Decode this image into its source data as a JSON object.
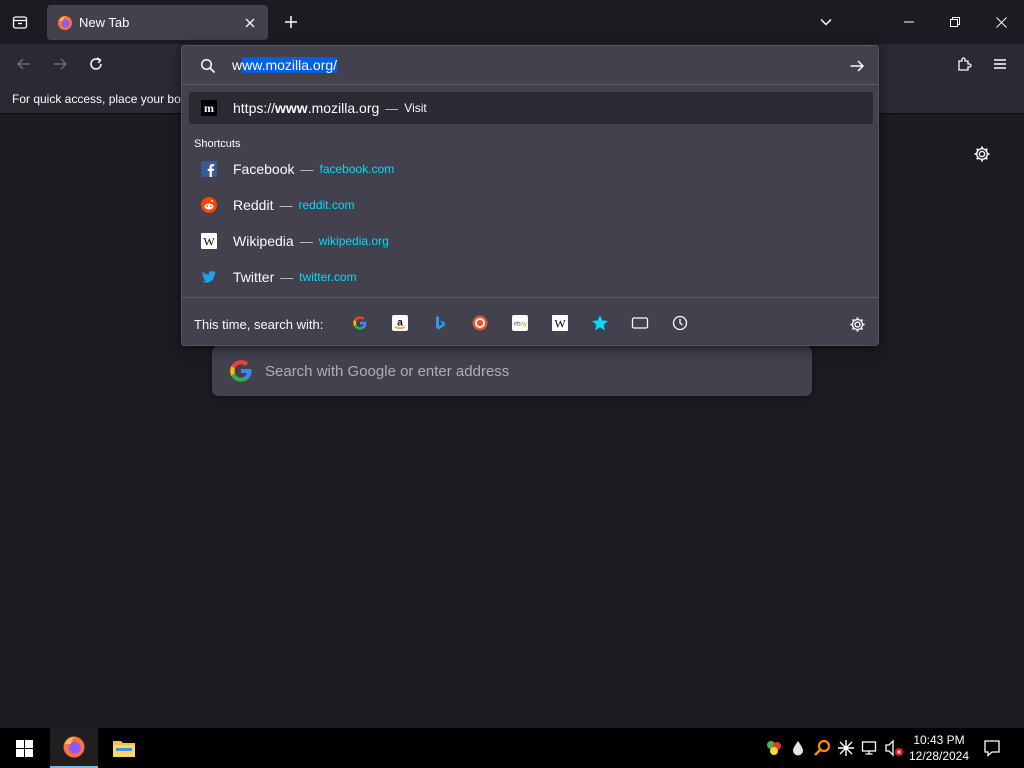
{
  "tab": {
    "title": "New Tab"
  },
  "bookmarks_bar": {
    "hint": "For quick access, place your bookmarks here on the bookmarks toolbar."
  },
  "urlbar": {
    "typed_prefix": "w",
    "autofill_selected": "ww.mozilla.org/",
    "results": [
      {
        "title_prefix": "https://",
        "title_bold": "www",
        "title_suffix": ".mozilla.org",
        "sep": "—",
        "action": "Visit"
      }
    ],
    "shortcuts_label": "Shortcuts",
    "shortcuts": [
      {
        "title": "Facebook",
        "sep": "—",
        "url": "facebook.com",
        "icon": "facebook-icon"
      },
      {
        "title": "Reddit",
        "sep": "—",
        "url": "reddit.com",
        "icon": "reddit-icon"
      },
      {
        "title": "Wikipedia",
        "sep": "—",
        "url": "wikipedia.org",
        "icon": "wikipedia-icon"
      },
      {
        "title": "Twitter",
        "sep": "—",
        "url": "twitter.com",
        "icon": "twitter-icon"
      }
    ],
    "one_off_label": "This time, search with:",
    "engines": [
      "google-icon",
      "amazon-icon",
      "bing-icon",
      "duckduckgo-icon",
      "ebay-icon",
      "wikipedia-icon",
      "bookmarks-star-icon",
      "tabs-icon",
      "history-icon"
    ]
  },
  "page": {
    "search_placeholder": "Search with Google or enter address"
  },
  "taskbar": {
    "time": "10:43 PM",
    "date": "12/28/2024"
  },
  "colors": {
    "accent": "#0060df",
    "link": "#00ddff",
    "background": "#1c1b22",
    "panel": "#42414d"
  }
}
